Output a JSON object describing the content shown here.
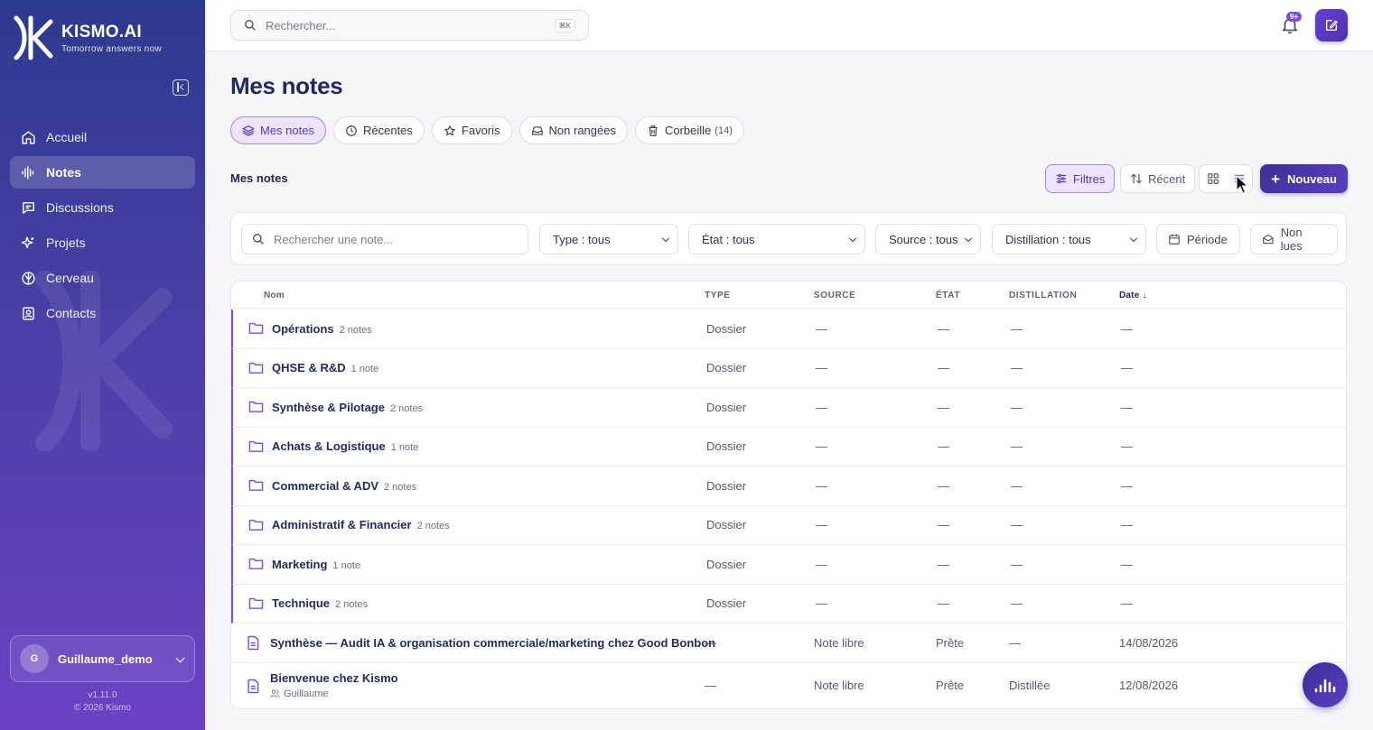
{
  "brand": {
    "name": "KISMO.AI",
    "tagline": "Tomorrow answers now"
  },
  "sidebar": {
    "items": [
      {
        "label": "Accueil",
        "icon": "home-icon"
      },
      {
        "label": "Notes",
        "icon": "waveform-icon",
        "active": true
      },
      {
        "label": "Discussions",
        "icon": "chat-icon"
      },
      {
        "label": "Projets",
        "icon": "sparkle-icon"
      },
      {
        "label": "Cerveau",
        "icon": "brain-icon"
      },
      {
        "label": "Contacts",
        "icon": "contact-card-icon"
      }
    ],
    "user": {
      "initial": "G",
      "name": "Guillaume_demo"
    },
    "version": "v1.11.0",
    "copyright": "© 2026 Kismo"
  },
  "topbar": {
    "search_placeholder": "Rechercher...",
    "shortcut": "⌘K",
    "notification_badge": "9+"
  },
  "page": {
    "title": "Mes notes",
    "tabs": [
      {
        "label": "Mes notes",
        "icon": "layers-icon",
        "active": true
      },
      {
        "label": "Récentes",
        "icon": "clock-icon"
      },
      {
        "label": "Favoris",
        "icon": "star-icon"
      },
      {
        "label": "Non rangées",
        "icon": "inbox-icon"
      },
      {
        "label": "Corbeille",
        "icon": "trash-icon",
        "count": "(14)"
      }
    ],
    "section_label": "Mes notes",
    "toolbar": {
      "filters": "Filtres",
      "sort": "Récent",
      "new": "Nouveau"
    }
  },
  "filters": {
    "search_placeholder": "Rechercher une note...",
    "type": "Type : tous",
    "state": "État : tous",
    "source": "Source : tous",
    "distillation": "Distillation : tous",
    "period": "Période",
    "unread": "Non lues"
  },
  "table": {
    "columns": {
      "name": "Nom",
      "type": "TYPE",
      "source": "SOURCE",
      "state": "ÉTAT",
      "distillation": "DISTILLATION",
      "date": "Date"
    },
    "rows": [
      {
        "kind": "folder",
        "name": "Opérations",
        "count": "2 notes",
        "type": "Dossier",
        "source": "—",
        "state": "—",
        "distillation": "—",
        "date": "—"
      },
      {
        "kind": "folder",
        "name": "QHSE & R&D",
        "count": "1 note",
        "type": "Dossier",
        "source": "—",
        "state": "—",
        "distillation": "—",
        "date": "—"
      },
      {
        "kind": "folder",
        "name": "Synthèse & Pilotage",
        "count": "2 notes",
        "type": "Dossier",
        "source": "—",
        "state": "—",
        "distillation": "—",
        "date": "—"
      },
      {
        "kind": "folder",
        "name": "Achats & Logistique",
        "count": "1 note",
        "type": "Dossier",
        "source": "—",
        "state": "—",
        "distillation": "—",
        "date": "—"
      },
      {
        "kind": "folder",
        "name": "Commercial & ADV",
        "count": "2 notes",
        "type": "Dossier",
        "source": "—",
        "state": "—",
        "distillation": "—",
        "date": "—"
      },
      {
        "kind": "folder",
        "name": "Administratif & Financier",
        "count": "2 notes",
        "type": "Dossier",
        "source": "—",
        "state": "—",
        "distillation": "—",
        "date": "—"
      },
      {
        "kind": "folder",
        "name": "Marketing",
        "count": "1 note",
        "type": "Dossier",
        "source": "—",
        "state": "—",
        "distillation": "—",
        "date": "—"
      },
      {
        "kind": "folder",
        "name": "Technique",
        "count": "2 notes",
        "type": "Dossier",
        "source": "—",
        "state": "—",
        "distillation": "—",
        "date": "—"
      },
      {
        "kind": "note",
        "name": "Synthèse — Audit IA & organisation commerciale/marketing chez Good Bonbon",
        "count": "",
        "type": "—",
        "source": "Note libre",
        "state": "Prête",
        "distillation": "—",
        "date": "14/08/2026"
      },
      {
        "kind": "note",
        "name": "Bienvenue chez Kismo",
        "count": "",
        "owner": "Guillaume",
        "type": "—",
        "source": "Note libre",
        "state": "Prête",
        "distillation": "Distillée",
        "date": "12/08/2026"
      }
    ]
  },
  "colors": {
    "accent": "#7b4ee0",
    "primary_dark": "#3c2f96",
    "title": "#1f2b5e"
  }
}
